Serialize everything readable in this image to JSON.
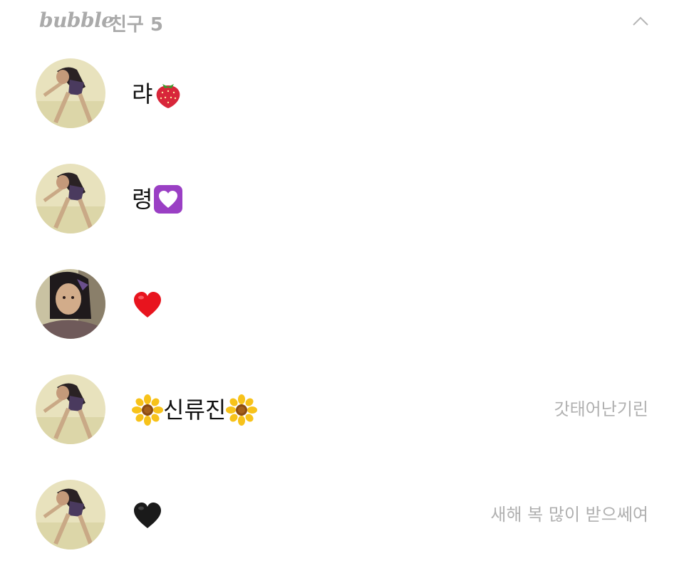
{
  "header": {
    "brand": "bubble",
    "section_title": "친구 5",
    "collapse_icon": "chevron-up-icon"
  },
  "friends": [
    {
      "prefix_emoji": "",
      "text": "랴",
      "suffix_emoji": "strawberry-icon",
      "status": "",
      "avatar": "avatar-beach-girl"
    },
    {
      "prefix_emoji": "",
      "text": "령",
      "suffix_emoji": "purple-heart-icon",
      "status": "",
      "avatar": "avatar-beach-girl"
    },
    {
      "prefix_emoji": "",
      "text": "",
      "suffix_emoji": "red-heart-icon",
      "status": "",
      "avatar": "avatar-closeup-girl"
    },
    {
      "prefix_emoji": "sunflower-icon",
      "text": "신류진",
      "suffix_emoji": "sunflower-icon",
      "status": "갓태어난기린",
      "avatar": "avatar-beach-girl"
    },
    {
      "prefix_emoji": "",
      "text": "",
      "suffix_emoji": "black-heart-icon",
      "status": "새해 복 많이 받으쎄여",
      "avatar": "avatar-beach-girl"
    }
  ],
  "colors": {
    "header_text": "#aaaaaa",
    "name_text": "#111111",
    "status_text": "#b0b0b0",
    "background": "#ffffff"
  }
}
